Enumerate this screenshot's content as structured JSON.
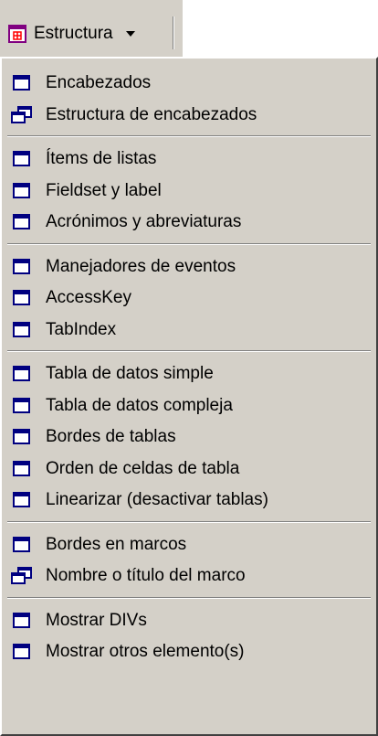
{
  "toolbar": {
    "button_label": "Estructura",
    "icon": "frame-grid-icon",
    "dropdown_icon": "chevron-down-icon"
  },
  "menu": {
    "groups": [
      [
        {
          "label": "Encabezados",
          "icon": "window-icon"
        },
        {
          "label": "Estructura de encabezados",
          "icon": "cascade-windows-icon"
        }
      ],
      [
        {
          "label": "Ítems de listas",
          "icon": "window-icon"
        },
        {
          "label": "Fieldset y label",
          "icon": "window-icon"
        },
        {
          "label": "Acrónimos y abreviaturas",
          "icon": "window-icon"
        }
      ],
      [
        {
          "label": "Manejadores de eventos",
          "icon": "window-icon"
        },
        {
          "label": "AccessKey",
          "icon": "window-icon"
        },
        {
          "label": "TabIndex",
          "icon": "window-icon"
        }
      ],
      [
        {
          "label": "Tabla de datos simple",
          "icon": "window-icon"
        },
        {
          "label": "Tabla de datos compleja",
          "icon": "window-icon"
        },
        {
          "label": "Bordes de tablas",
          "icon": "window-icon"
        },
        {
          "label": "Orden de celdas de tabla",
          "icon": "window-icon"
        },
        {
          "label": "Linearizar (desactivar tablas)",
          "icon": "window-icon"
        }
      ],
      [
        {
          "label": "Bordes en marcos",
          "icon": "window-icon"
        },
        {
          "label": "Nombre o título del marco",
          "icon": "cascade-windows-icon"
        }
      ],
      [
        {
          "label": "Mostrar DIVs",
          "icon": "window-icon"
        },
        {
          "label": "Mostrar otros elemento(s)",
          "icon": "window-icon"
        }
      ]
    ]
  },
  "colors": {
    "menu_bg": "#d4d0c8",
    "icon_blue": "#000080",
    "icon_red": "#ff0000",
    "icon_purple": "#800080"
  }
}
